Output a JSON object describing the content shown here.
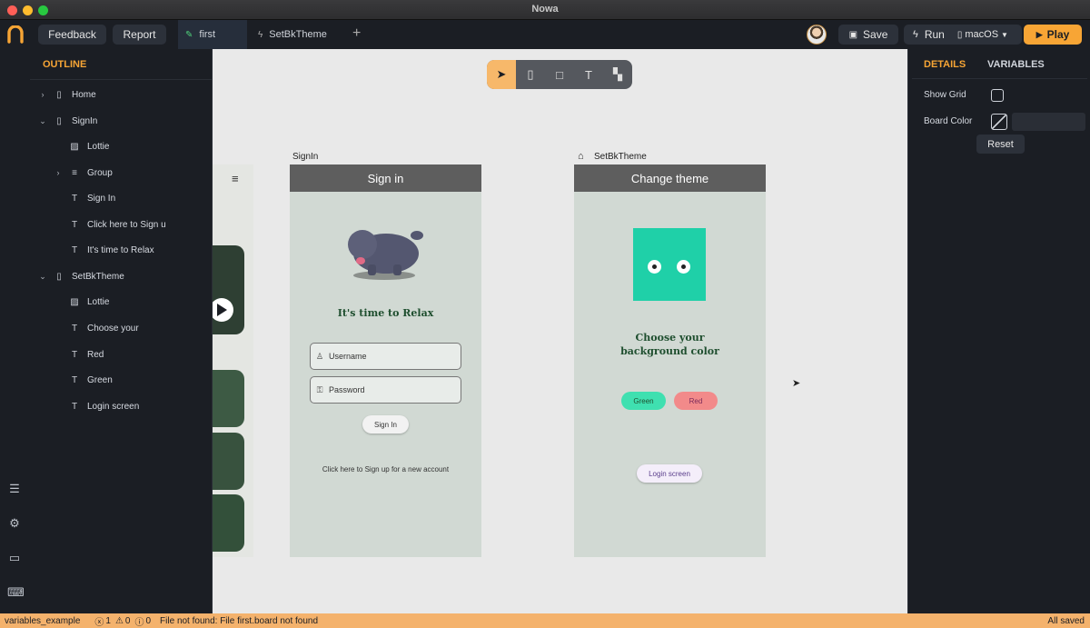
{
  "window": {
    "title": "Nowa"
  },
  "toolbar": {
    "feedback": "Feedback",
    "report": "Report",
    "tabs": [
      {
        "label": "first",
        "icon": "edit-icon"
      },
      {
        "label": "SetBkTheme",
        "icon": "bolt-icon"
      }
    ],
    "add_tab": "+",
    "save": "Save",
    "run": "Run",
    "platform": "macOS",
    "play": "Play"
  },
  "outline": {
    "title": "OUTLINE",
    "items": [
      {
        "label": "Home",
        "icon": "phone-icon",
        "chevron": "›"
      },
      {
        "label": "SignIn",
        "icon": "phone-icon",
        "chevron": "⌄"
      },
      {
        "label": "Lottie",
        "icon": "image-icon"
      },
      {
        "label": "Group",
        "icon": "list-icon",
        "chevron": "›"
      },
      {
        "label": "Sign In",
        "icon": "text-icon"
      },
      {
        "label": "Click here to Sign u",
        "icon": "text-icon"
      },
      {
        "label": "It's time to Relax",
        "icon": "text-icon"
      },
      {
        "label": "SetBkTheme",
        "icon": "phone-icon",
        "chevron": "⌄"
      },
      {
        "label": "Lottie",
        "icon": "image-icon"
      },
      {
        "label": "Choose your",
        "icon": "text-icon"
      },
      {
        "label": "Red",
        "icon": "text-icon"
      },
      {
        "label": "Green",
        "icon": "text-icon"
      },
      {
        "label": "Login screen",
        "icon": "text-icon"
      }
    ]
  },
  "canvas": {
    "signin": {
      "label": "SignIn",
      "appbar": "Sign in",
      "heading": "It's time to Relax",
      "username_placeholder": "Username",
      "password_placeholder": "Password",
      "signin_button": "Sign In",
      "signup_link": "Click here to Sign up for a new account"
    },
    "theme": {
      "label": "SetBkTheme",
      "appbar": "Change theme",
      "heading_line1": "Choose your",
      "heading_line2": "background color",
      "green_button": "Green",
      "red_button": "Red",
      "login_button": "Login screen",
      "accent": "#1fd0a8"
    }
  },
  "details": {
    "tab_details": "DETAILS",
    "tab_variables": "VARIABLES",
    "show_grid_label": "Show Grid",
    "board_color_label": "Board Color",
    "reset": "Reset"
  },
  "statusbar": {
    "project": "variables_example",
    "errors": "1",
    "warnings": "0",
    "infos": "0",
    "message": "File not found: File first.board not found",
    "save_state": "All saved"
  },
  "colors": {
    "accent": "#f7a535",
    "panel_bg": "#1b1e24",
    "canvas_bg": "#e9e9e9",
    "statusbar_bg": "#f4b26c"
  }
}
